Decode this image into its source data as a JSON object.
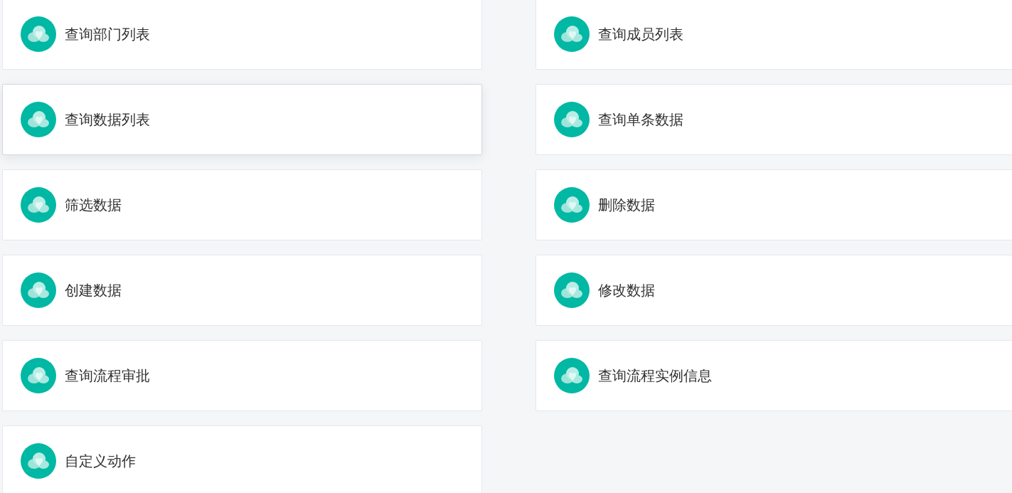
{
  "actions": [
    {
      "label": "查询部门列表",
      "hovered": false
    },
    {
      "label": "查询成员列表",
      "hovered": false
    },
    {
      "label": "查询数据列表",
      "hovered": true
    },
    {
      "label": "查询单条数据",
      "hovered": false
    },
    {
      "label": "筛选数据",
      "hovered": false
    },
    {
      "label": "删除数据",
      "hovered": false
    },
    {
      "label": "创建数据",
      "hovered": false
    },
    {
      "label": "修改数据",
      "hovered": false
    },
    {
      "label": "查询流程审批",
      "hovered": false
    },
    {
      "label": "查询流程实例信息",
      "hovered": false
    },
    {
      "label": "自定义动作",
      "hovered": false
    }
  ]
}
